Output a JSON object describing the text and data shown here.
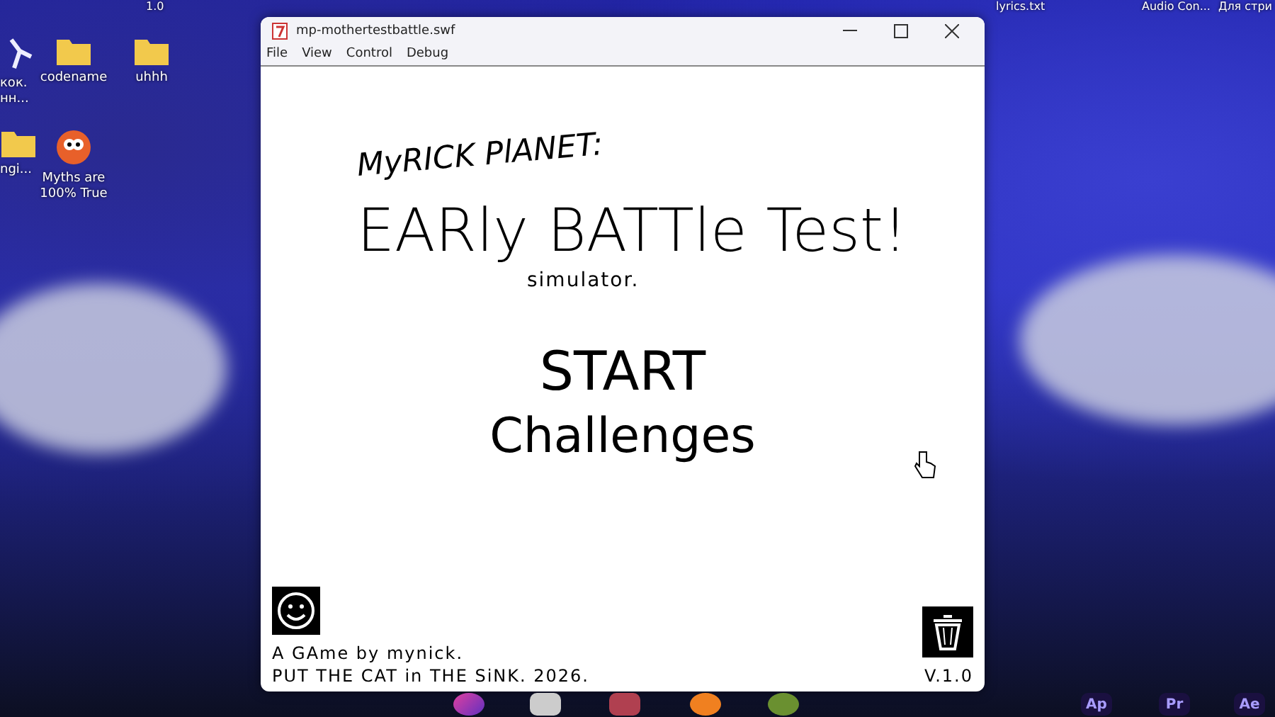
{
  "desktop": {
    "top_labels": [
      "1.0",
      "lyrics.txt",
      "Audio Con...",
      "Для стри"
    ],
    "icons": [
      {
        "kind": "app",
        "lines": [
          "кок.",
          "нн..."
        ]
      },
      {
        "kind": "folder",
        "lines": [
          "codename"
        ]
      },
      {
        "kind": "folder",
        "lines": [
          "uhhh"
        ]
      },
      {
        "kind": "folder",
        "lines": [
          "ngi..."
        ]
      },
      {
        "kind": "game",
        "lines": [
          "Myths are",
          "100% True"
        ]
      }
    ]
  },
  "window": {
    "title": "mp-mothertestbattle.swf",
    "menu": [
      "File",
      "View",
      "Control",
      "Debug"
    ],
    "game": {
      "subtitle": "MyRICK PlANET:",
      "title": "EARly BATTle Test!",
      "tagline": "simulator.",
      "buttons": [
        "START",
        "Challenges"
      ],
      "credits": [
        "A GAme by mynick.",
        "PUT THE CAT in THE SiNK. 2026."
      ],
      "version": "V.1.0"
    }
  },
  "taskbar": {
    "apps": [
      {
        "kind": "ball"
      },
      {
        "kind": "tile"
      },
      {
        "kind": "castle"
      },
      {
        "kind": "blender"
      },
      {
        "kind": "fruit"
      },
      {
        "kind": "label",
        "label": "Ap"
      },
      {
        "kind": "label",
        "label": "Pr"
      },
      {
        "kind": "label",
        "label": "Ae"
      }
    ]
  }
}
